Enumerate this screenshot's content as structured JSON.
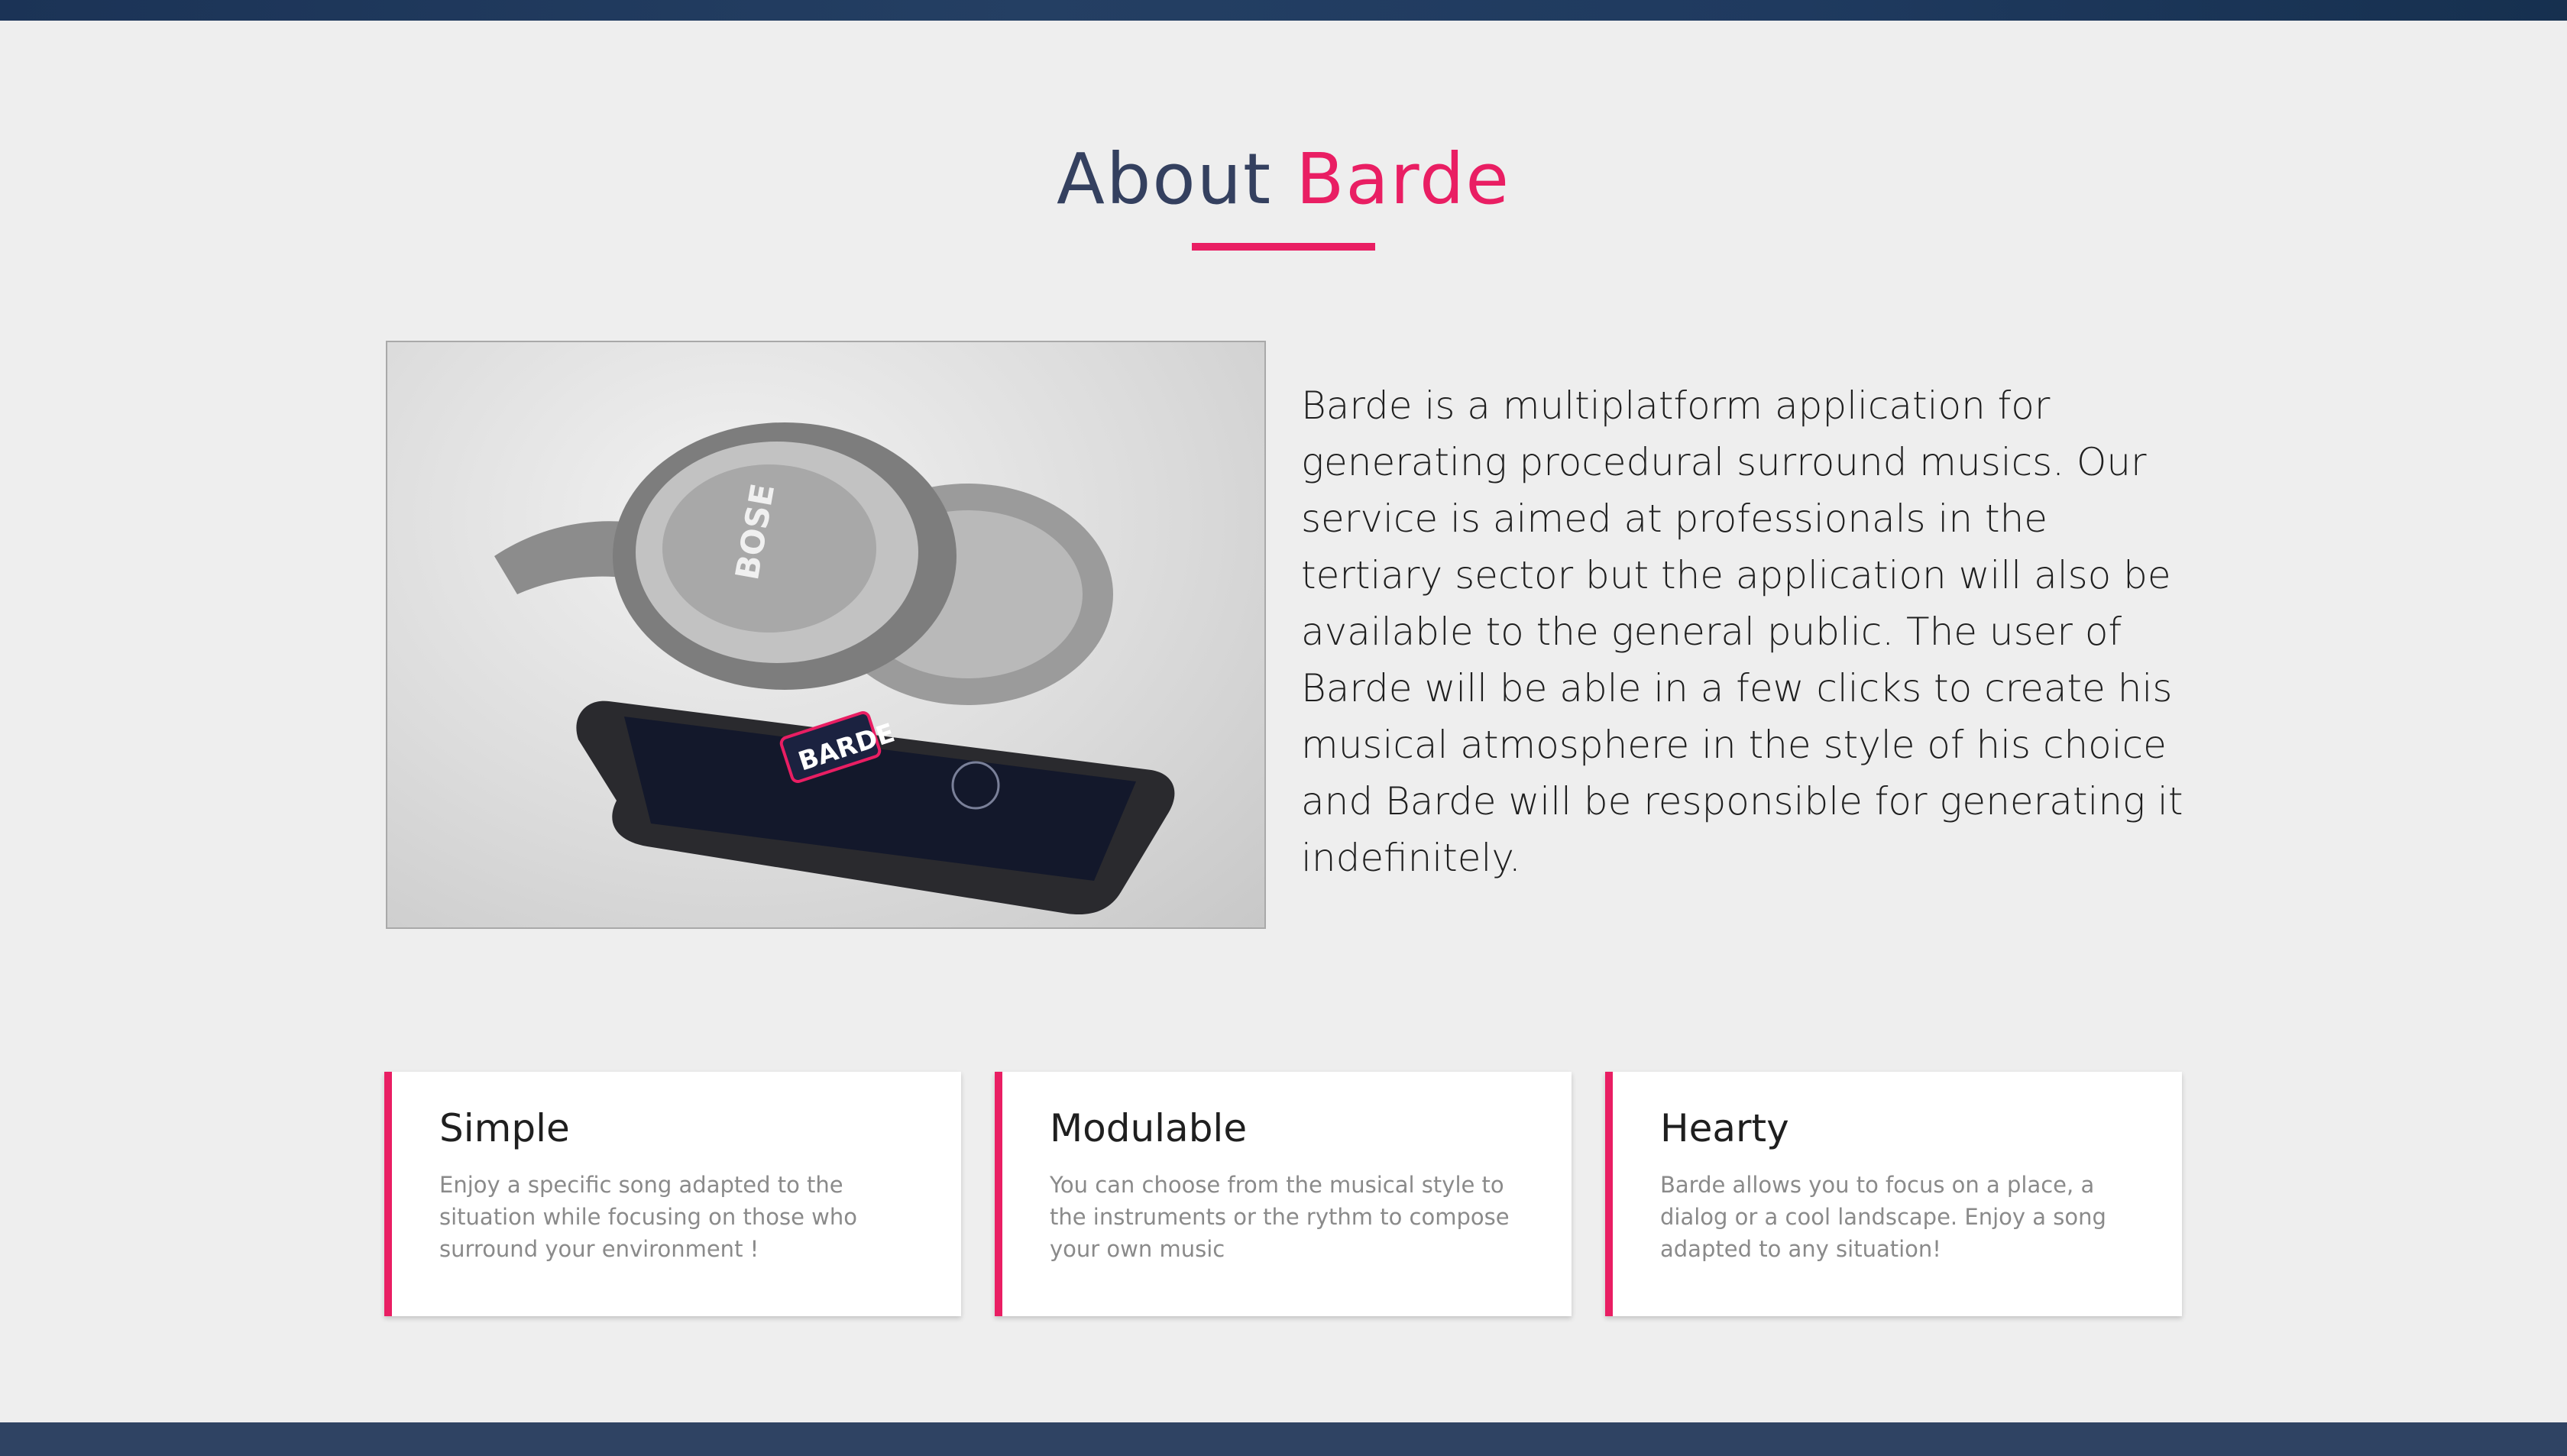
{
  "header_bar": {},
  "about": {
    "title_part_1": "About",
    "title_part_2": "Barde",
    "accent_color": "#e91e63",
    "title_color": "#34405f",
    "image": {
      "description_icon": "headphones-phone-photo-icon",
      "brand_text": "BOSE",
      "app_logo_text": "BARDE"
    },
    "description": "Barde is a multiplatform application for generating procedural surround musics. Our service is aimed at professionals in the tertiary sector but the application will also be available to the general public. The user of Barde will be able in a few clicks to create his musical atmosphere in the style of his choice and Barde will be responsible for generating it indefinitely."
  },
  "features": [
    {
      "title": "Simple",
      "text": "Enjoy a specific song adapted to the situation while focusing on those who surround your environment !"
    },
    {
      "title": "Modulable",
      "text": "You can choose from the musical style to the instruments or the rythm to compose your own music"
    },
    {
      "title": "Hearty",
      "text": "Barde allows you to focus on a place, a dialog or a cool landscape. Enjoy a song adapted to any situation!"
    }
  ]
}
